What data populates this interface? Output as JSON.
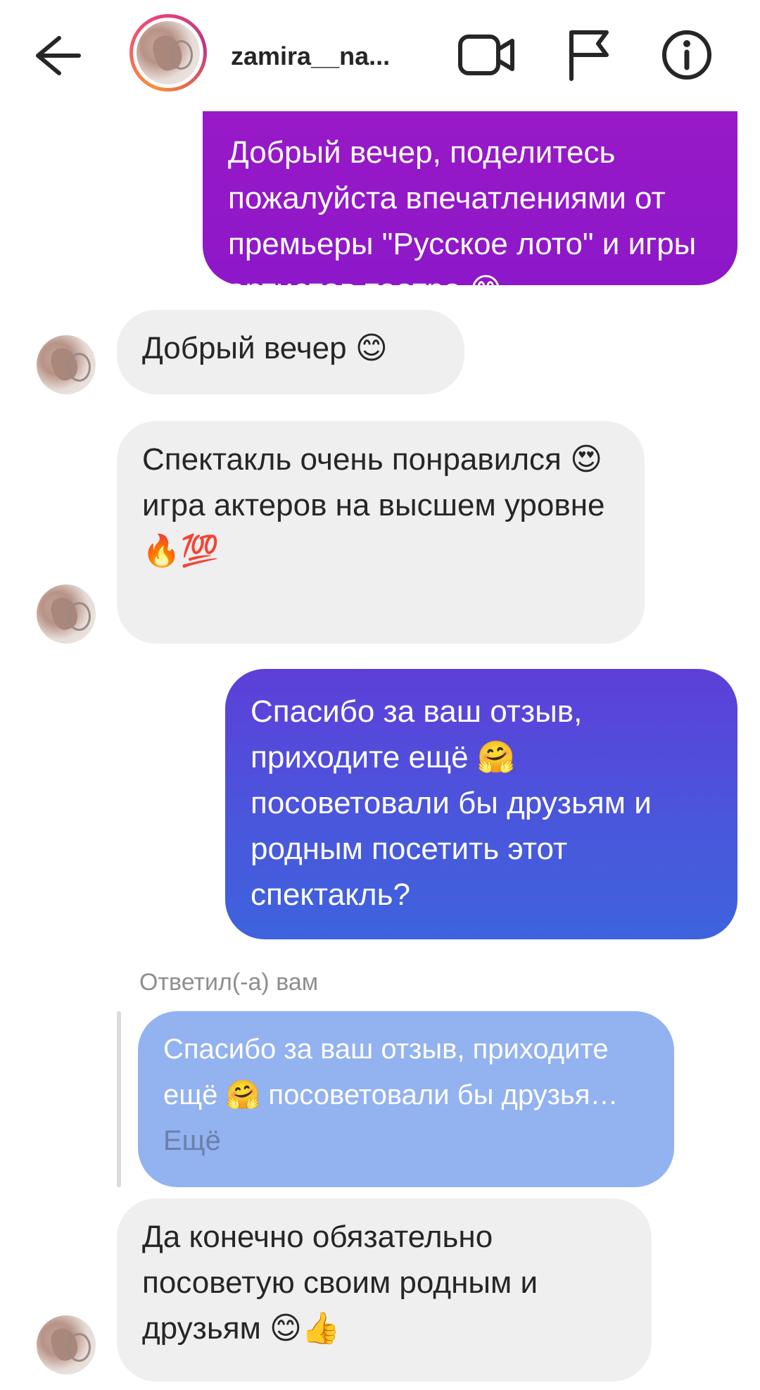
{
  "header": {
    "username": "zamira__na...",
    "icons": {
      "back": "arrow-left-icon",
      "video": "video-call-icon",
      "flag": "flag-icon",
      "info": "info-icon"
    }
  },
  "messages": [
    {
      "direction": "outgoing",
      "text": "Добрый вечер, поделитесь пожалуйста впечатлениями от премьеры \"Русское лото\" и игры артистов театра 😊"
    },
    {
      "direction": "incoming",
      "text": "Добрый вечер 😊"
    },
    {
      "direction": "incoming",
      "text": "Спектакль очень понравился 😍 игра актеров на высшем уровне 🔥💯"
    },
    {
      "direction": "outgoing",
      "text": "Спасибо за ваш отзыв, приходите ещё 🤗 посоветовали бы друзьям и родным посетить этот спектакль?"
    },
    {
      "direction": "incoming",
      "text": "Да конечно обязательно посоветую своим родным и друзьям 😊👍"
    }
  ],
  "reply": {
    "label": "Ответил(-а) вам",
    "quote": "Спасибо за ваш отзыв, приходите ещё 🤗 посоветовали бы друзья…",
    "more": "Ещё"
  },
  "colors": {
    "outgoing_purple": "#9b19c6",
    "outgoing_blue": "#4a56dc",
    "incoming_bg": "#efefef",
    "reply_quote_bg": "#93b2f0"
  }
}
